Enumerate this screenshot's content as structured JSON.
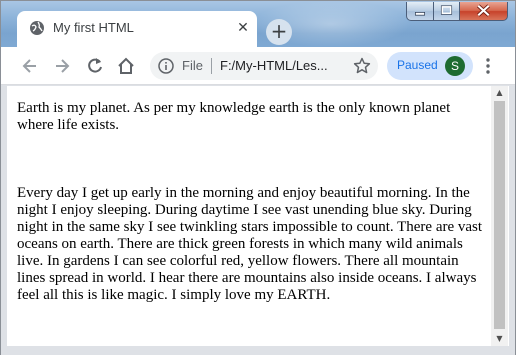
{
  "browser": {
    "tab": {
      "title": "My first HTML",
      "close_glyph": "✕"
    },
    "new_tab_glyph": "+",
    "omnibox": {
      "scheme_label": "File",
      "url": "F:/My-HTML/Les..."
    },
    "profile": {
      "status": "Paused",
      "avatar_letter": "S"
    },
    "icons": {
      "tab": "globe-icon",
      "back": "back-arrow-icon",
      "forward": "forward-arrow-icon",
      "reload": "reload-icon",
      "home": "home-icon",
      "info": "info-icon",
      "bookmark": "star-icon",
      "menu": "kebab-menu-icon"
    },
    "colors": {
      "accent": "#1a73e8",
      "avatar": "#1e6b31",
      "close_button": "#c7422a"
    }
  },
  "page": {
    "paragraphs": [
      "Earth is my planet. As per my knowledge earth is the only known planet where life exists.",
      "Every day I get up early in the morning and enjoy beautiful morning. In the night I enjoy sleeping. During daytime I see vast unending blue sky. During night in the same sky I see twinkling stars impossible to count. There are vast oceans on earth. There are thick green forests in which many wild animals live. In gardens I can see colorful red, yellow flowers. There all mountain lines spread in world. I hear there are mountains also inside oceans. I always feel all this is like magic. I simply love my EARTH."
    ]
  }
}
